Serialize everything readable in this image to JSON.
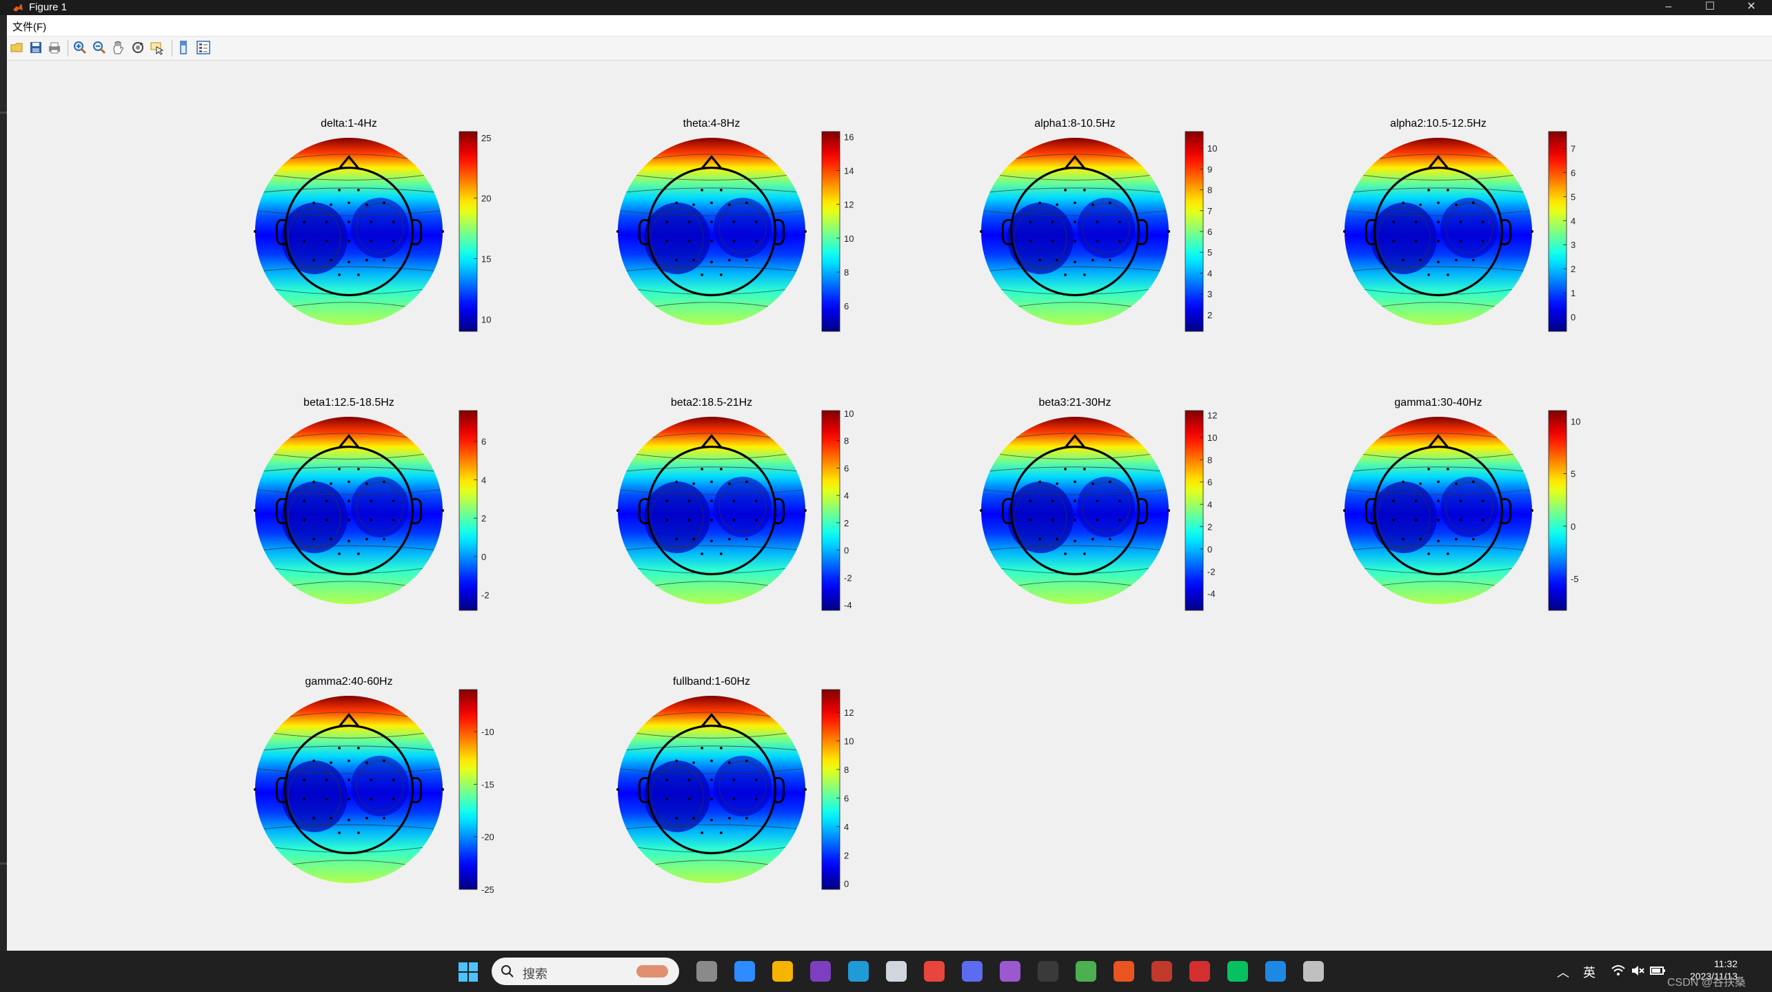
{
  "window": {
    "title": "Figure 1",
    "menu_file": "文件(F)",
    "controls": {
      "minimize": "–",
      "maximize": "☐",
      "close": "✕"
    }
  },
  "toolbar": {
    "buttons": [
      "open-icon",
      "save-icon",
      "print-icon",
      "zoom-in-icon",
      "zoom-out-icon",
      "pan-icon",
      "rotate-icon",
      "data-cursor-icon",
      "colorbar-icon",
      "legend-icon"
    ]
  },
  "chart_data": [
    {
      "type": "heatmap",
      "title": "delta:1-4Hz",
      "colorbar_ticks": [
        10,
        15,
        20,
        25
      ],
      "clim": [
        9.0,
        25.5
      ]
    },
    {
      "type": "heatmap",
      "title": "theta:4-8Hz",
      "colorbar_ticks": [
        6,
        8,
        10,
        12,
        14,
        16
      ],
      "clim": [
        4.5,
        16.3
      ]
    },
    {
      "type": "heatmap",
      "title": "alpha1:8-10.5Hz",
      "colorbar_ticks": [
        2,
        3,
        4,
        5,
        6,
        7,
        8,
        9,
        10
      ],
      "clim": [
        1.2,
        10.8
      ]
    },
    {
      "type": "heatmap",
      "title": "alpha2:10.5-12.5Hz",
      "colorbar_ticks": [
        0,
        1,
        2,
        3,
        4,
        5,
        6,
        7
      ],
      "clim": [
        -0.6,
        7.7
      ]
    },
    {
      "type": "heatmap",
      "title": "beta1:12.5-18.5Hz",
      "colorbar_ticks": [
        -2,
        0,
        2,
        4,
        6
      ],
      "clim": [
        -2.8,
        7.6
      ]
    },
    {
      "type": "heatmap",
      "title": "beta2:18.5-21Hz",
      "colorbar_ticks": [
        -4,
        -2,
        0,
        2,
        4,
        6,
        8,
        10
      ],
      "clim": [
        -4.4,
        10.2
      ]
    },
    {
      "type": "heatmap",
      "title": "beta3:21-30Hz",
      "colorbar_ticks": [
        -4,
        -2,
        0,
        2,
        4,
        6,
        8,
        10,
        12
      ],
      "clim": [
        -5.5,
        12.4
      ]
    },
    {
      "type": "heatmap",
      "title": "gamma1:30-40Hz",
      "colorbar_ticks": [
        -5,
        0,
        5,
        10
      ],
      "clim": [
        -8.0,
        11.0
      ]
    },
    {
      "type": "heatmap",
      "title": "gamma2:40-60Hz",
      "colorbar_ticks": [
        -25,
        -20,
        -15,
        -10
      ],
      "clim": [
        -25.0,
        -6.0
      ]
    },
    {
      "type": "heatmap",
      "title": "fullband:1-60Hz",
      "colorbar_ticks": [
        0,
        2,
        4,
        6,
        8,
        10,
        12
      ],
      "clim": [
        -0.4,
        13.6
      ]
    }
  ],
  "taskbar": {
    "search_label": "搜索",
    "apps": [
      "file-view-icon",
      "widgets-icon",
      "file-explorer-icon",
      "onenote-icon",
      "edge-icon",
      "notepad-icon",
      "chrome-icon",
      "snipping-icon",
      "visual-studio-icon",
      "code-icon",
      "colored-app-icon",
      "ubuntu-icon",
      "wps-icon",
      "red-app-icon",
      "wechat-icon",
      "blue-app-icon",
      "matlab-icon"
    ],
    "tray": {
      "ime": "英"
    },
    "clock_time": "11:32",
    "clock_date": "2023/11/13",
    "watermark": "CSDN @谷扶桑"
  },
  "colors": {
    "figure_bg": "#f0f0f0",
    "jet_low": "#00008f",
    "jet_high": "#800000"
  }
}
